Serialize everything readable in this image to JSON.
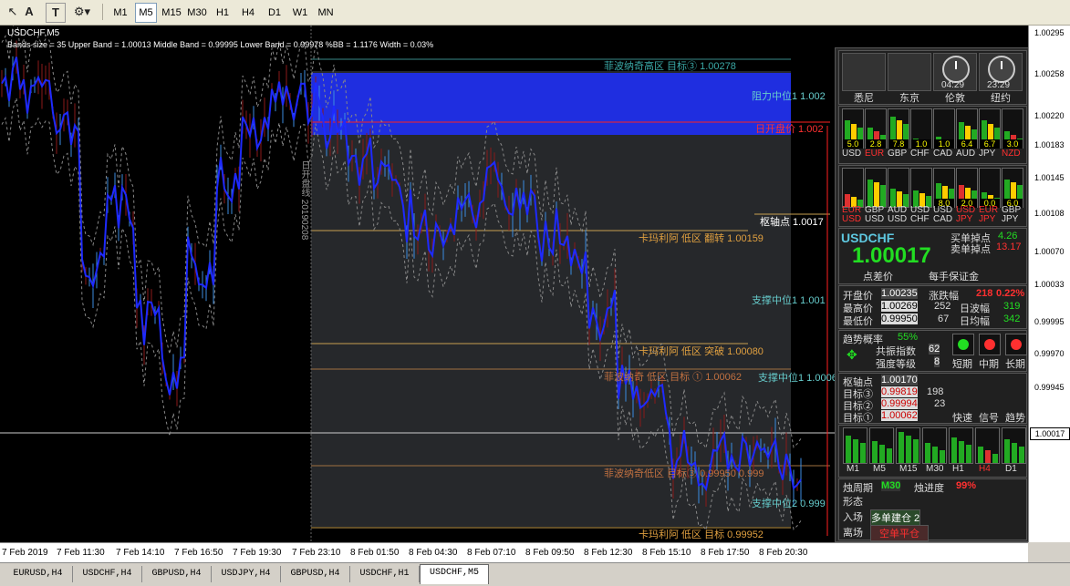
{
  "toolbar": {
    "timeframes": [
      "M1",
      "M5",
      "M15",
      "M30",
      "H1",
      "H4",
      "D1",
      "W1",
      "MN"
    ],
    "active_timeframe": "M5",
    "icons": [
      "cursor-icon",
      "text-a-icon",
      "text-t-icon",
      "shapes-icon"
    ]
  },
  "chart": {
    "title": "USDCHF,M5",
    "indicator_info": "Bands size = 35 Upper Band = 1.00013 Middle Band = 0.99995 Lower Band = 0.99978 %BB = 1.1176 Width = 0.03%",
    "vertical_text": "日开盘线 20190208",
    "labels": {
      "pivot_high_top": "菲波纳奇高区 目标③ 1.00278",
      "resistance_mid": "阻力中位1 1.002",
      "day_open": "日开盘价 1.002",
      "pivot": "枢轴点 1.0017",
      "camarilla_reverse": "卡玛利阿 低区 翻转 1.00159",
      "support_mid1": "支撑中位1 1.001",
      "camarilla_break": "卡玛利阿 低区 突破 1.00080",
      "fib_target1": "菲波纳奇 低区 目标 ① 1.00062",
      "support_mid1b": "支撑中位1 1.0006",
      "fib_low": "菲波纳奇低区 目标③ 0.99950 0.999",
      "support_mid2": "支撑中位2 0.999",
      "camarilla_target": "卡玛利阿 低区 目标 0.99952"
    }
  },
  "price_axis": [
    "1.00295",
    "1.00258",
    "1.00220",
    "1.00183",
    "1.00145",
    "1.00108",
    "1.00070",
    "1.00033",
    "0.99995",
    "0.99970",
    "0.99945"
  ],
  "current_price": "1.00017",
  "time_axis": [
    "7 Feb 2019",
    "7 Feb 11:30",
    "7 Feb 14:10",
    "7 Feb 16:50",
    "7 Feb 19:30",
    "7 Feb 23:10",
    "8 Feb 01:50",
    "8 Feb 04:30",
    "8 Feb 07:10",
    "8 Feb 09:50",
    "8 Feb 12:30",
    "8 Feb 15:10",
    "8 Feb 17:50",
    "8 Feb 20:30"
  ],
  "tabs": [
    "EURUSD,H4",
    "USDCHF,H4",
    "GBPUSD,H4",
    "USDJPY,H4",
    "GBPUSD,H4",
    "USDCHF,H1",
    "USDCHF,M5"
  ],
  "active_tab": "USDCHF,M5",
  "panel": {
    "markets": [
      "悉尼",
      "东京",
      "伦敦",
      "纽约"
    ],
    "clock_times": [
      "04:29",
      "23:29"
    ],
    "currencies": [
      "USD",
      "EUR",
      "GBP",
      "CHF",
      "CAD",
      "AUD",
      "JPY",
      "NZD"
    ],
    "currency_values": [
      "5.0",
      "2.8",
      "7.8",
      "1.0",
      "1.0",
      "6.4",
      "6.7",
      "3.0"
    ],
    "pair_values": [
      "8.0",
      "2.0",
      "0.0",
      "6.0"
    ],
    "pairs_top": [
      "EUR",
      "GBP",
      "AUD",
      "USD",
      "USD",
      "USD",
      "EUR",
      "GBP"
    ],
    "pairs_bottom": [
      "USD",
      "USD",
      "USD",
      "CHF",
      "CAD",
      "JPY",
      "JPY",
      "JPY"
    ],
    "symbol": "USDCHF",
    "price": "1.00017",
    "buy_slip_label": "买单掉点",
    "buy_slip": "4.26",
    "sell_slip_label": "卖单掉点",
    "sell_slip": "13.17",
    "spread_label": "点差价",
    "margin_label": "每手保证金",
    "open_label": "开盘价",
    "open": "1.00235",
    "change_label": "涨跌幅",
    "change_points": "218",
    "change_pct": "0.22%",
    "high_label": "最高价",
    "high": "1.00269",
    "high_n": "252",
    "daily_range_label": "日波幅",
    "daily_range": "319",
    "low_label": "最低价",
    "low": "0.99950",
    "low_n": "67",
    "daily_avg_label": "日均幅",
    "daily_avg": "342",
    "trend_label": "趋势概率",
    "trend_prob": "55%",
    "power_label": "共振指数",
    "power": "62",
    "strength_label": "强度等级",
    "strength": "8",
    "term_labels": [
      "短期",
      "中期",
      "长期"
    ],
    "pivot_label": "枢轴点",
    "pivot": "1.00170",
    "targets": [
      {
        "label": "目标③",
        "value": "0.99819",
        "n": "198"
      },
      {
        "label": "目标②",
        "value": "0.99994",
        "n": "23"
      },
      {
        "label": "目标①",
        "value": "1.00062",
        "n": ""
      }
    ],
    "signal_labels": [
      "快速",
      "信号",
      "趋势"
    ],
    "tf_labels": [
      "M1",
      "M5",
      "M15",
      "M30",
      "H1",
      "H4",
      "D1"
    ],
    "cycle_label": "烛周期",
    "cycle": "M30",
    "progress_label": "烛进度",
    "progress": "99%",
    "pattern_label": "形态",
    "entry_label": "入场",
    "entry": "多单建仓 2",
    "exit_label": "离场",
    "exit": "空单平仓",
    "bottom_tf_labels": [
      "M1",
      "M5",
      "M15",
      "M30",
      "H1",
      "H4",
      "D1"
    ]
  },
  "colors": {
    "blue_zone": "#1f2ee0",
    "red_line": "#ff2020",
    "gold_line": "#c8a050",
    "green_price": "#22dd22"
  }
}
